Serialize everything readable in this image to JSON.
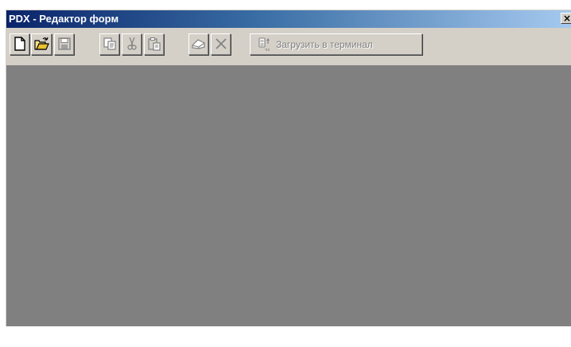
{
  "window": {
    "title": "PDX - Редактор форм",
    "close_glyph": "×"
  },
  "toolbar": {
    "buttons": [
      {
        "name": "new",
        "icon": "new-document-icon",
        "enabled": true
      },
      {
        "name": "open",
        "icon": "open-folder-icon",
        "enabled": true
      },
      {
        "name": "save",
        "icon": "save-disk-icon",
        "enabled": false
      },
      {
        "name": "copy",
        "icon": "copy-icon",
        "enabled": false
      },
      {
        "name": "cut",
        "icon": "scissors-icon",
        "enabled": false
      },
      {
        "name": "paste",
        "icon": "paste-clipboard-icon",
        "enabled": false
      },
      {
        "name": "erase",
        "icon": "eraser-icon",
        "enabled": false
      },
      {
        "name": "delete",
        "icon": "delete-x-icon",
        "enabled": false
      }
    ],
    "upload_label": "Загрузить в терминал",
    "upload_icon": "terminal-upload-icon",
    "upload_enabled": false
  },
  "colors": {
    "titlebar_start": "#0a246a",
    "titlebar_end": "#a6caf0",
    "face": "#d4d0c8",
    "workspace": "#808080",
    "disabled_text": "#808080"
  }
}
